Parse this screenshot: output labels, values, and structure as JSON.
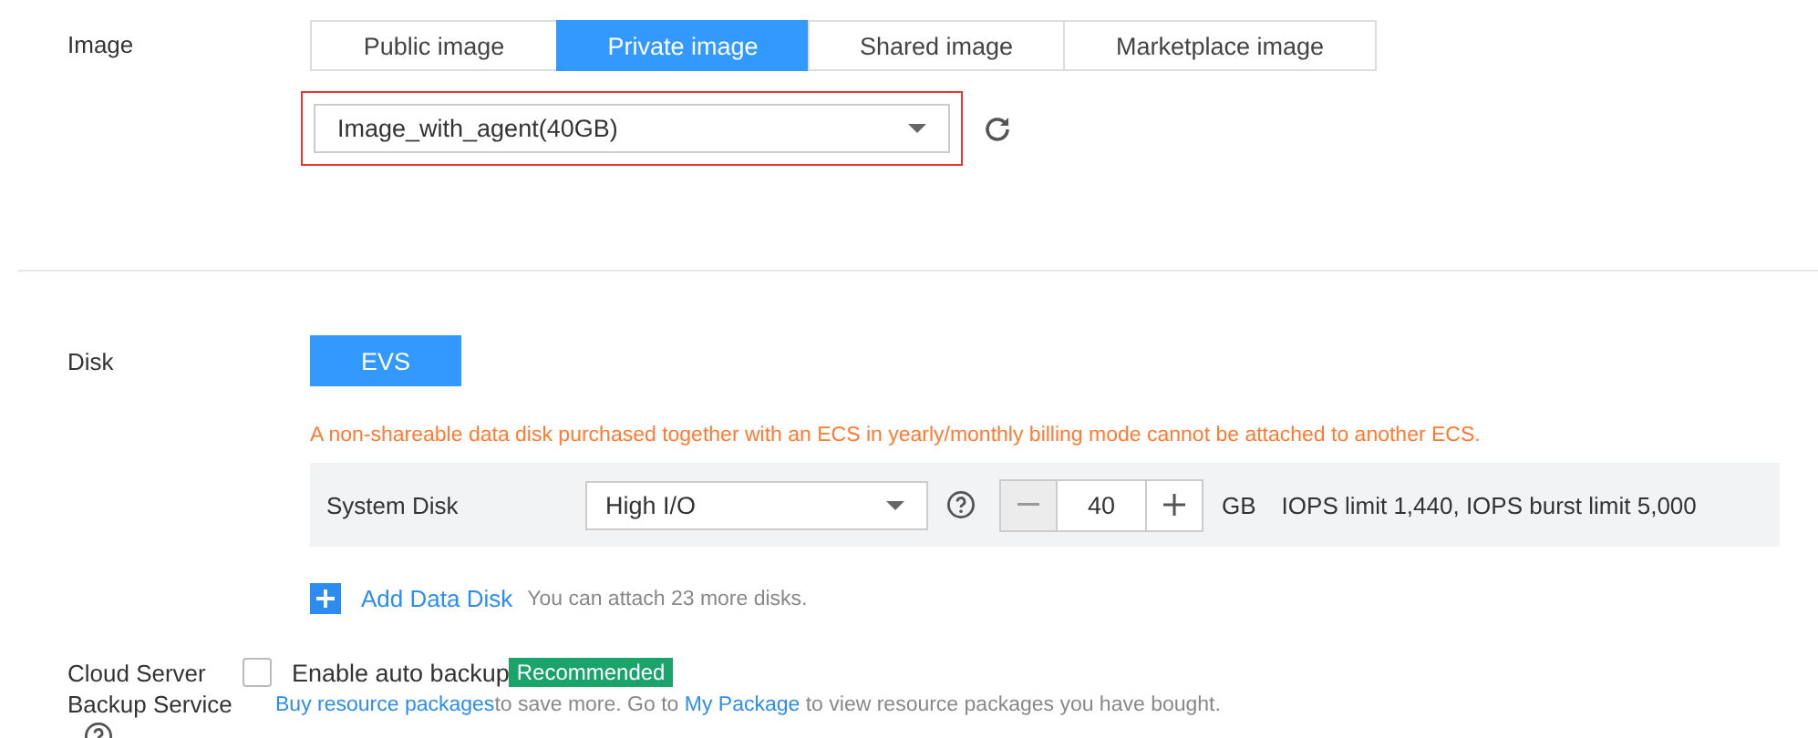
{
  "image": {
    "label": "Image",
    "tabs": [
      {
        "label": "Public image",
        "selected": false
      },
      {
        "label": "Private image",
        "selected": true
      },
      {
        "label": "Shared image",
        "selected": false
      },
      {
        "label": "Marketplace image",
        "selected": false
      }
    ],
    "select": {
      "value": "Image_with_agent(40GB)",
      "highlighted": true
    }
  },
  "disk": {
    "label": "Disk",
    "type_button": "EVS",
    "warning": "A non-shareable data disk purchased together with an ECS in yearly/monthly billing mode cannot be attached to another ECS.",
    "system_disk": {
      "label": "System Disk",
      "type": "High I/O",
      "size": "40",
      "unit": "GB",
      "info": "IOPS limit 1,440, IOPS burst limit 5,000"
    },
    "add_link": "Add Data Disk",
    "add_hint": "You can attach 23 more disks."
  },
  "backup": {
    "label": "Cloud Server Backup Service",
    "checkbox": {
      "label": "Enable auto backup",
      "checked": false
    },
    "badge": "Recommended",
    "note": [
      {
        "kind": "link",
        "text": "Buy resource packages"
      },
      {
        "kind": "text",
        "text": "to save more. Go to "
      },
      {
        "kind": "link",
        "text": "My Package"
      },
      {
        "kind": "text",
        "text": " to view resource packages you have bought."
      }
    ]
  }
}
